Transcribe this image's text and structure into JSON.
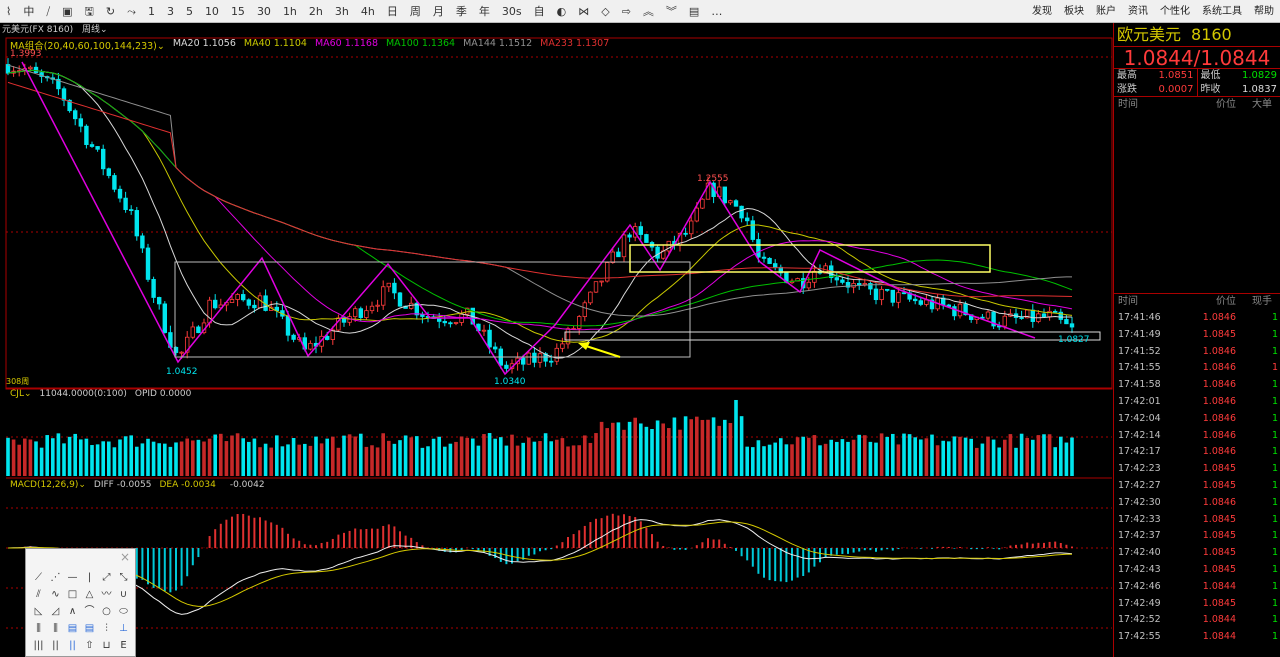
{
  "toolbar": {
    "items": [
      "⌇",
      "中",
      "⧸",
      "▣",
      "🖫",
      "↻",
      "⤳",
      "1",
      "3",
      "5",
      "10",
      "15",
      "30",
      "1h",
      "2h",
      "3h",
      "4h",
      "日",
      "周",
      "月",
      "季",
      "年",
      "30s",
      "自",
      "◐",
      "⋈",
      "◇",
      "⇨",
      "︽",
      "︾",
      "▤",
      "…"
    ],
    "menus": [
      "发现",
      "板块",
      "账户",
      "资讯",
      "个性化",
      "系统工具",
      "帮助"
    ]
  },
  "title": {
    "symbol": "元美元(FX 8160)",
    "period": "周线⌄",
    "period_count": "308周"
  },
  "ma_legend": [
    {
      "label": "MA组合(20,40,60,100,144,233)⌄",
      "color": "#d4c800"
    },
    {
      "label": "MA20 1.1056",
      "color": "#d8d8d8"
    },
    {
      "label": "MA40 1.1104",
      "color": "#c8c800"
    },
    {
      "label": "MA60 1.1168",
      "color": "#e000e0"
    },
    {
      "label": "MA100 1.1364",
      "color": "#00c000"
    },
    {
      "label": "MA144 1.1512",
      "color": "#909090"
    },
    {
      "label": "MA233 1.1307",
      "color": "#e03030"
    }
  ],
  "chart_labels": {
    "high_start": "1.3993",
    "high_mid": "1.2555",
    "low1": "1.0452",
    "low2": "1.0340",
    "last": "1.0827"
  },
  "volume": {
    "name": "CJL⌄",
    "value": "11044.0000(0:100)",
    "opid": "OPID 0.0000"
  },
  "macd": {
    "name": "MACD(12,26,9)⌄",
    "diff": "DIFF -0.0055",
    "dea": "DEA -0.0034",
    "macd": "-0.0042"
  },
  "quote": {
    "name": "欧元美元",
    "code": "8160",
    "price": "1.0844/1.0844",
    "high_label": "最高",
    "high": "1.0851",
    "low_label": "最低",
    "low": "1.0829",
    "chg_label": "涨跌",
    "chg": "0.0007",
    "prev_label": "昨收",
    "prev": "1.0837",
    "big_headers": [
      "时间",
      "价位",
      "大单"
    ],
    "tick_headers": [
      "时间",
      "价位",
      "现手"
    ],
    "ticks": [
      [
        "17:41:46",
        "1.0846",
        "1",
        "g"
      ],
      [
        "17:41:49",
        "1.0845",
        "1",
        "g"
      ],
      [
        "17:41:52",
        "1.0846",
        "1",
        "g"
      ],
      [
        "17:41:55",
        "1.0846",
        "1",
        "r"
      ],
      [
        "17:41:58",
        "1.0846",
        "1",
        "g"
      ],
      [
        "17:42:01",
        "1.0846",
        "1",
        "g"
      ],
      [
        "17:42:04",
        "1.0846",
        "1",
        "g"
      ],
      [
        "17:42:14",
        "1.0846",
        "1",
        "g"
      ],
      [
        "17:42:17",
        "1.0846",
        "1",
        "g"
      ],
      [
        "17:42:23",
        "1.0845",
        "1",
        "g"
      ],
      [
        "17:42:27",
        "1.0845",
        "1",
        "g"
      ],
      [
        "17:42:30",
        "1.0846",
        "1",
        "g"
      ],
      [
        "17:42:33",
        "1.0845",
        "1",
        "g"
      ],
      [
        "17:42:37",
        "1.0845",
        "1",
        "g"
      ],
      [
        "17:42:40",
        "1.0845",
        "1",
        "g"
      ],
      [
        "17:42:43",
        "1.0845",
        "1",
        "g"
      ],
      [
        "17:42:46",
        "1.0844",
        "1",
        "g"
      ],
      [
        "17:42:49",
        "1.0845",
        "1",
        "g"
      ],
      [
        "17:42:52",
        "1.0844",
        "1",
        "g"
      ],
      [
        "17:42:55",
        "1.0844",
        "1",
        "g"
      ]
    ]
  },
  "drawing_tools": {
    "close": "×",
    "items": [
      "⟋",
      "⋰",
      "—",
      "|",
      "⤢",
      "⤡",
      "⫽",
      "∿",
      "□",
      "△",
      "〰",
      "∪",
      "◺",
      "◿",
      "∧",
      "⌒",
      "○",
      "⬭",
      "⫼",
      "⫼",
      "▤",
      "▤",
      "⫶",
      "⊥",
      "|||",
      "||",
      "||",
      "⇧",
      "⊔",
      "E"
    ]
  }
}
